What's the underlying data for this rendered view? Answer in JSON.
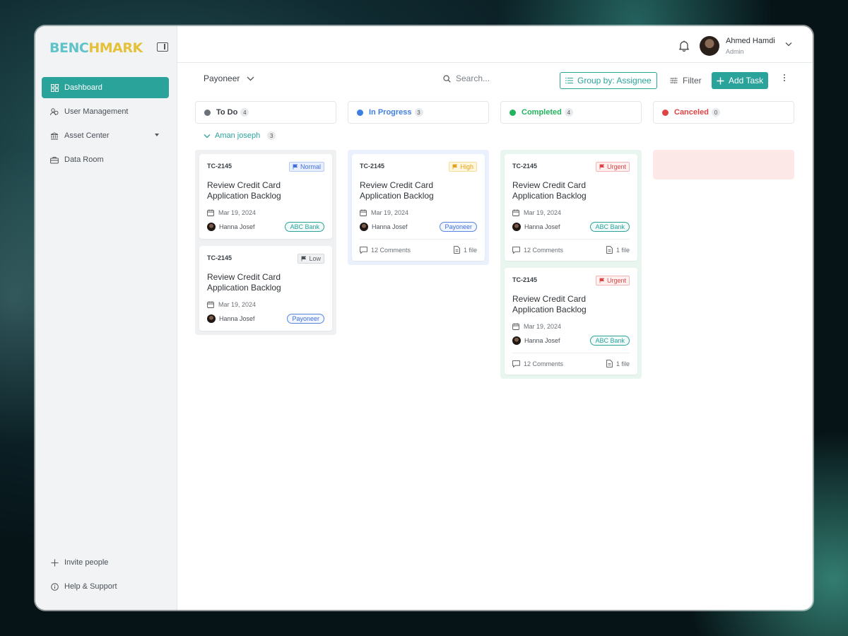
{
  "sidebar": {
    "logo_part1": "BENC",
    "logo_part2": "H",
    "logo_part3": "MARK",
    "items": [
      {
        "label": "Dashboard",
        "icon": "grid-icon"
      },
      {
        "label": "User Management",
        "icon": "users-icon"
      },
      {
        "label": "Asset Center",
        "icon": "bank-icon"
      },
      {
        "label": "Data Room",
        "icon": "briefcase-icon"
      }
    ],
    "bottom": [
      {
        "label": "Invite people",
        "icon": "plus-icon"
      },
      {
        "label": "Help & Support",
        "icon": "info-icon"
      }
    ]
  },
  "header": {
    "user_name": "Ahmed Hamdi",
    "user_role": "Admin"
  },
  "toolbar": {
    "workspace": "Payoneer",
    "search_placeholder": "Search...",
    "group_by": "Group by: Assignee",
    "filter": "Filter",
    "add_task": "Add Task"
  },
  "columns": [
    {
      "label": "To Do",
      "count": "4",
      "color": "#6b7178"
    },
    {
      "label": "In Progress",
      "count": "3",
      "color": "#3f7fe0"
    },
    {
      "label": "Completed",
      "count": "4",
      "color": "#22b35e"
    },
    {
      "label": "Canceled",
      "count": "0",
      "color": "#df4444"
    }
  ],
  "group": {
    "name": "Aman joseph",
    "count": "3"
  },
  "cards": {
    "todo1": {
      "id": "TC-2145",
      "priority": "Normal",
      "title": "Review Credit Card Application Backlog",
      "date": "Mar 19, 2024",
      "assignee": "Hanna Josef",
      "tag": "ABC Bank"
    },
    "todo2": {
      "id": "TC-2145",
      "priority": "Low",
      "title": "Review Credit Card Application Backlog",
      "date": "Mar 19, 2024",
      "assignee": "Hanna Josef",
      "tag": "Payoneer"
    },
    "prog1": {
      "id": "TC-2145",
      "priority": "High",
      "title": "Review Credit Card Application Backlog",
      "date": "Mar 19, 2024",
      "assignee": "Hanna Josef",
      "tag": "Payoneer",
      "comments": "12 Comments",
      "files": "1 file"
    },
    "done1": {
      "id": "TC-2145",
      "priority": "Urgent",
      "title": "Review Credit Card Application Backlog",
      "date": "Mar 19, 2024",
      "assignee": "Hanna Josef",
      "tag": "ABC Bank",
      "comments": "12 Comments",
      "files": "1 file"
    },
    "done2": {
      "id": "TC-2145",
      "priority": "Urgent",
      "title": "Review Credit Card Application Backlog",
      "date": "Mar 19, 2024",
      "assignee": "Hanna Josef",
      "tag": "ABC Bank",
      "comments": "12 Comments",
      "files": "1 file"
    }
  }
}
